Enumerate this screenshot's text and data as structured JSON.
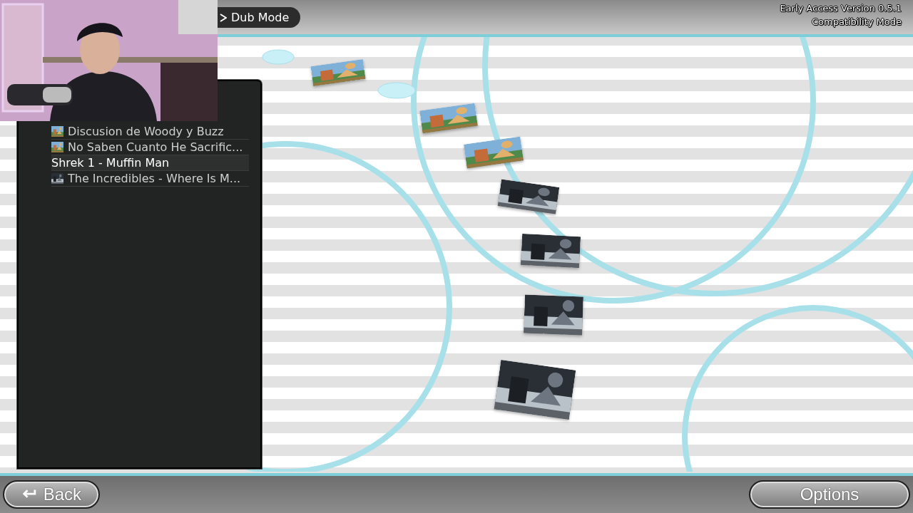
{
  "header": {
    "mode": "Dub Mode",
    "version": "Early Access Version 0.5.1",
    "compatibility": "Compatibility Mode"
  },
  "songs": [
    {
      "title": "Discusion de Woody y Buzz",
      "thumbnail": true,
      "selected": false
    },
    {
      "title": "No Saben Cuanto He Sacrific...",
      "thumbnail": true,
      "selected": false
    },
    {
      "title": "Shrek 1 - Muffin Man",
      "thumbnail": false,
      "selected": true
    },
    {
      "title": "The Incredibles - Where Is M...",
      "thumbnail": true,
      "selected": false
    }
  ],
  "footer": {
    "back": "Back",
    "options": "Options"
  }
}
